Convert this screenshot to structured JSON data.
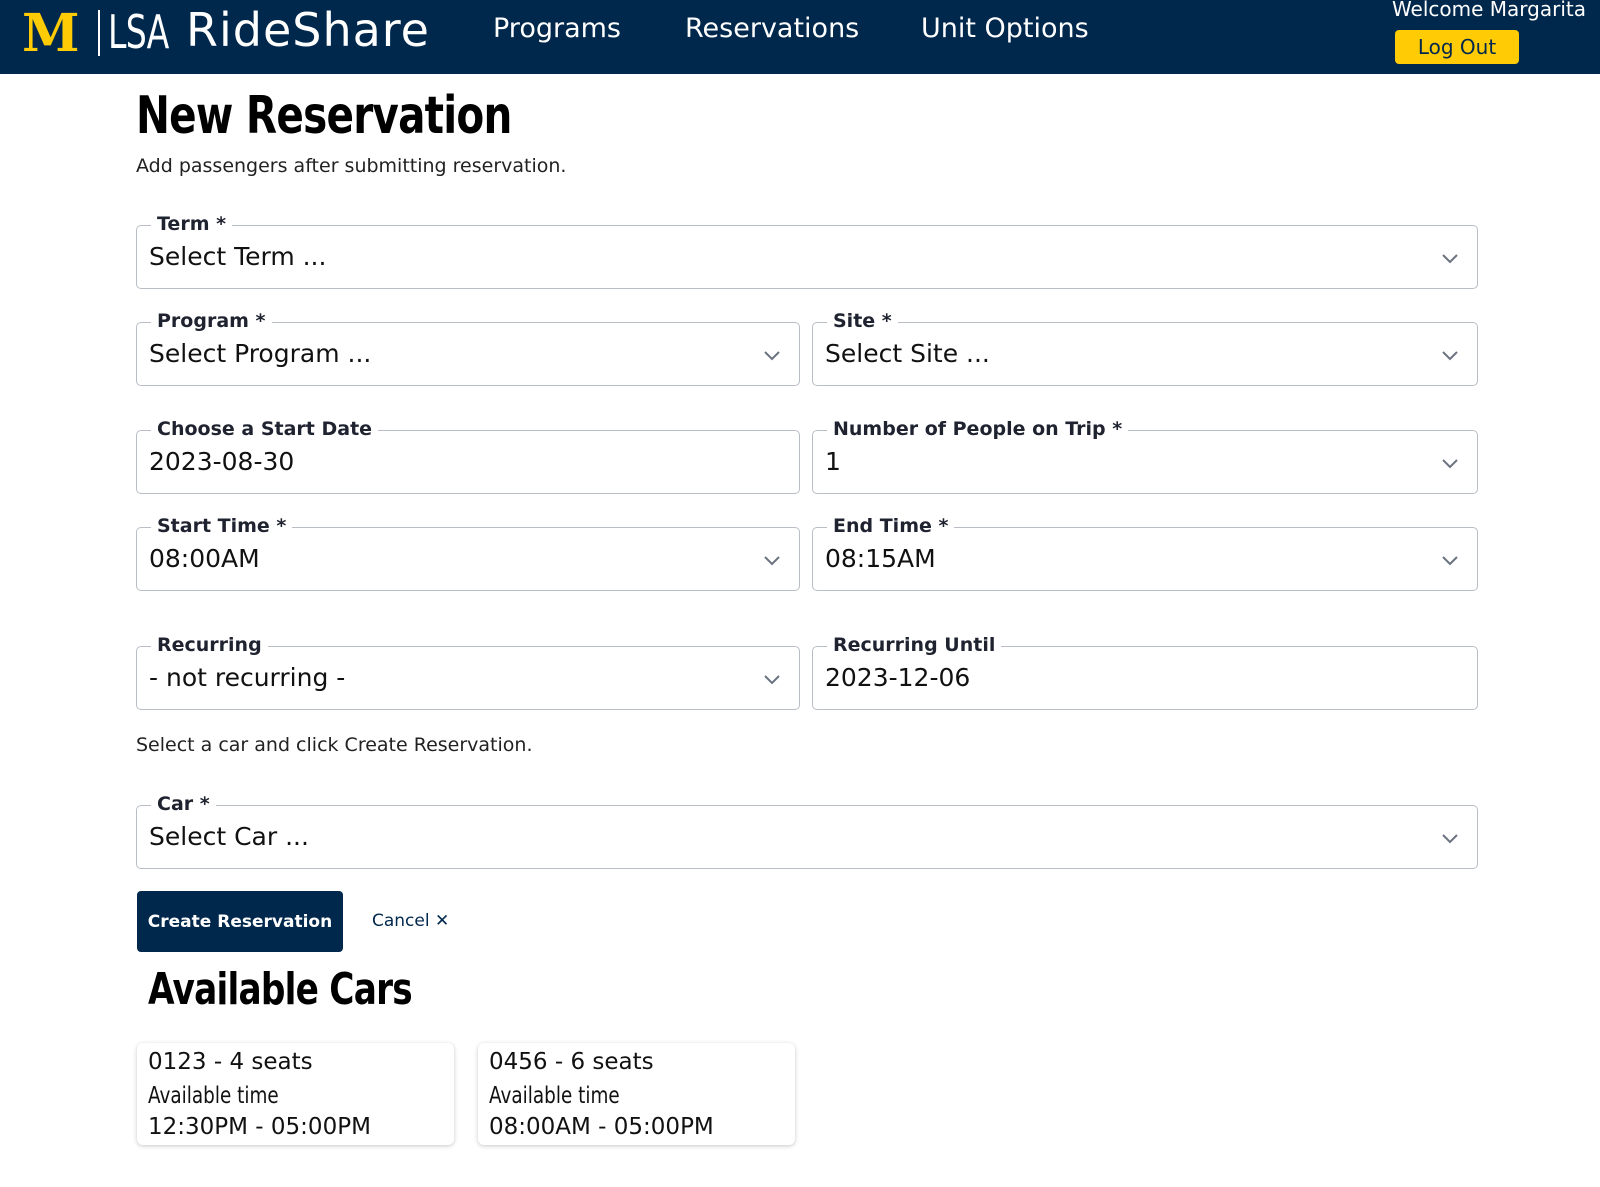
{
  "header": {
    "logo_m": "M",
    "logo_lsa": "LSA",
    "app_name": "RideShare",
    "nav": [
      "Programs",
      "Reservations",
      "Unit Options"
    ],
    "welcome": "Welcome Margarita",
    "logout_label": "Log Out"
  },
  "colors": {
    "brand_blue": "#00274c",
    "brand_maize": "#ffcb05"
  },
  "page": {
    "title": "New Reservation",
    "subtitle": "Add passengers after submitting reservation."
  },
  "form": {
    "term": {
      "label": "Term *",
      "value": "Select Term ..."
    },
    "program": {
      "label": "Program *",
      "value": "Select Program ..."
    },
    "site": {
      "label": "Site *",
      "value": "Select Site ..."
    },
    "start_date": {
      "label": "Choose a Start Date",
      "value": "2023-08-30"
    },
    "people": {
      "label": "Number of People on Trip *",
      "value": "1"
    },
    "start_time": {
      "label": "Start Time *",
      "value": "08:00AM"
    },
    "end_time": {
      "label": "End Time *",
      "value": "08:15AM"
    },
    "recurring": {
      "label": "Recurring",
      "value": "- not recurring -"
    },
    "recurring_until": {
      "label": "Recurring Until",
      "value": "2023-12-06"
    },
    "car_hint": "Select a car and click Create Reservation.",
    "car": {
      "label": "Car *",
      "value": "Select Car ..."
    },
    "create_label": "Create Reservation",
    "cancel_label": "Cancel",
    "cancel_icon": "✕"
  },
  "available": {
    "title": "Available Cars",
    "cars": [
      {
        "name": "0123 - 4 seats",
        "avail_label": "Available time",
        "time": "12:30PM - 05:00PM"
      },
      {
        "name": "0456 - 6 seats",
        "avail_label": "Available time",
        "time": "08:00AM - 05:00PM"
      }
    ]
  },
  "icons": {
    "dropdown": "chevron-down-icon",
    "cancel": "close-icon"
  }
}
